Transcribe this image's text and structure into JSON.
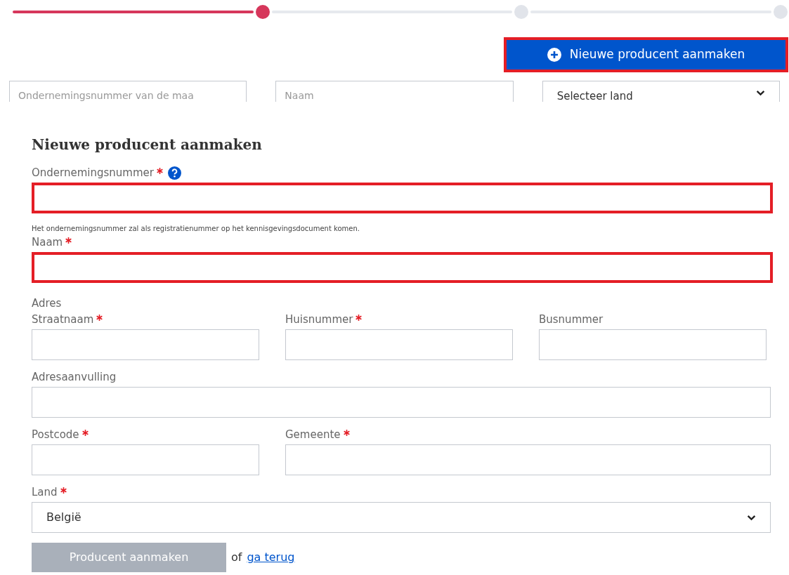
{
  "stepper": [
    {
      "selected": true
    },
    {
      "selected": false
    },
    {
      "selected": false
    }
  ],
  "new_button": {
    "label": "Nieuwe producent aanmaken",
    "highlighted": true
  },
  "filters": [
    {
      "kind": "input",
      "placeholder": "Ondernemingsnummer van de maa"
    },
    {
      "kind": "input",
      "placeholder": "Naam"
    },
    {
      "kind": "select",
      "value": "Selecteer land"
    }
  ],
  "form": {
    "title": "Nieuwe producent aanmaken",
    "rows": [
      {
        "fields": [
          {
            "kind": "input",
            "label": "Ondernemingsnummer",
            "required": true,
            "help": true,
            "highlighted": true
          }
        ]
      },
      {
        "note": "Het ondernemingsnummer zal als registratienummer op het kennisgevingsdocument komen."
      },
      {
        "fields": [
          {
            "kind": "input",
            "label": "Naam",
            "required": true,
            "highlighted": true
          }
        ]
      },
      {
        "heading": "Adres"
      },
      {
        "fields": [
          {
            "kind": "input",
            "label": "Straatnaam",
            "required": true,
            "highlighted": false
          },
          {
            "kind": "input",
            "label": "Huisnummer",
            "required": true,
            "highlighted": false
          },
          {
            "kind": "input",
            "label": "Busnummer",
            "required": false,
            "highlighted": false
          }
        ]
      },
      {
        "fields": [
          {
            "kind": "input",
            "label": "Adresaanvulling",
            "required": false,
            "highlighted": false
          }
        ]
      },
      {
        "fields": [
          {
            "kind": "input",
            "label": "Postcode",
            "required": true,
            "highlighted": false
          },
          {
            "kind": "input",
            "label": "Gemeente",
            "required": true,
            "highlighted": false
          }
        ]
      },
      {
        "fields": [
          {
            "kind": "select",
            "label": "Land",
            "required": true,
            "highlighted": false,
            "value": "België"
          }
        ]
      }
    ],
    "submit": {
      "label": "Producent aanmaken",
      "disabled": true
    },
    "or_text": "of",
    "back_link": "ga terug"
  }
}
